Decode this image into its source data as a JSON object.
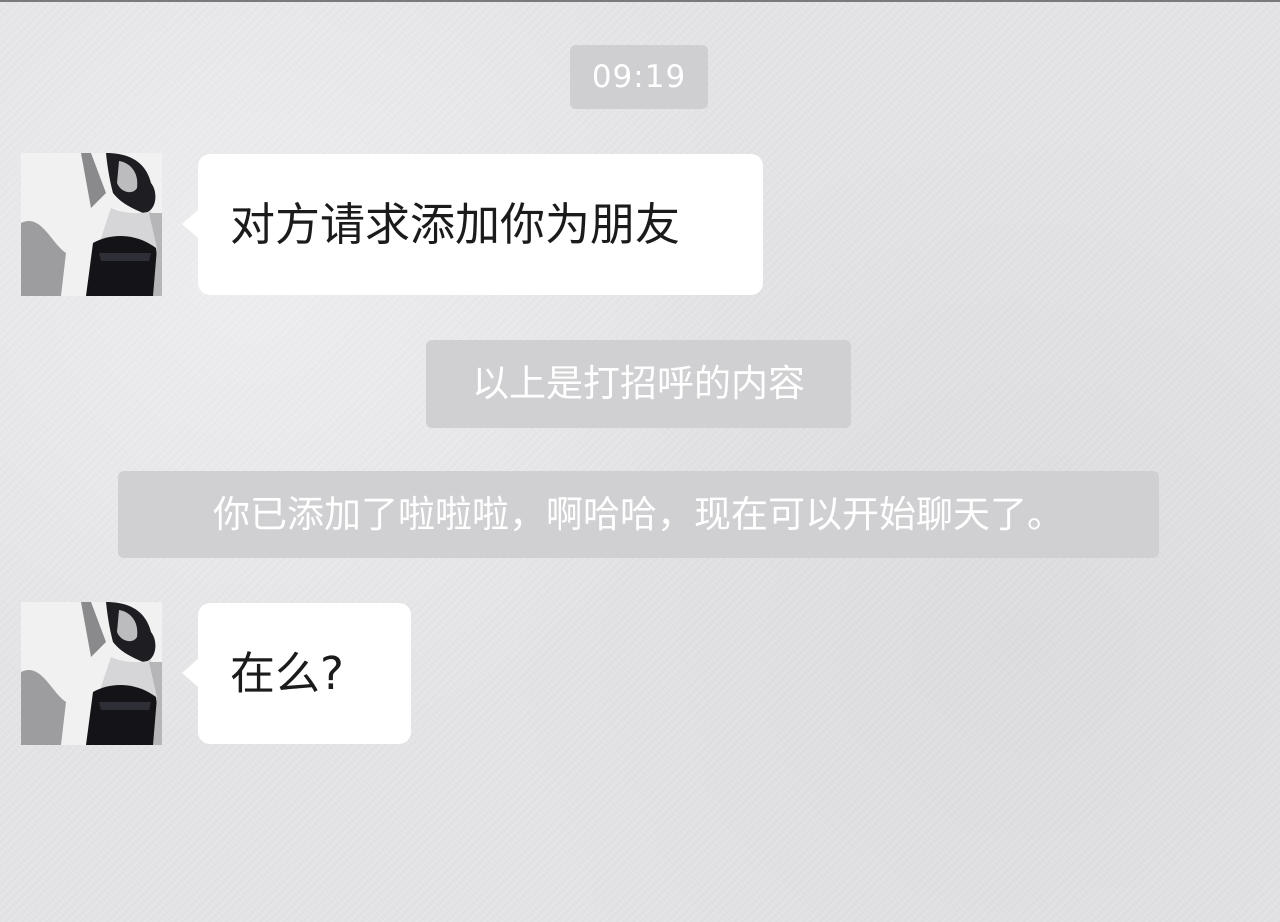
{
  "chat": {
    "timestamp": "09:19",
    "messages": [
      {
        "text": "对方请求添加你为朋友"
      },
      {
        "text": "在么?"
      }
    ],
    "system_notices": [
      {
        "text": "以上是打招呼的内容"
      },
      {
        "text": "你已添加了啦啦啦，啊哈哈，现在可以开始聊天了。"
      }
    ]
  },
  "colors": {
    "background": "#e6e5e8",
    "bubble": "#ffffff",
    "notice_bg": "#d0cfd2",
    "text_dark": "#1b1b1b",
    "text_light": "#ffffff"
  }
}
